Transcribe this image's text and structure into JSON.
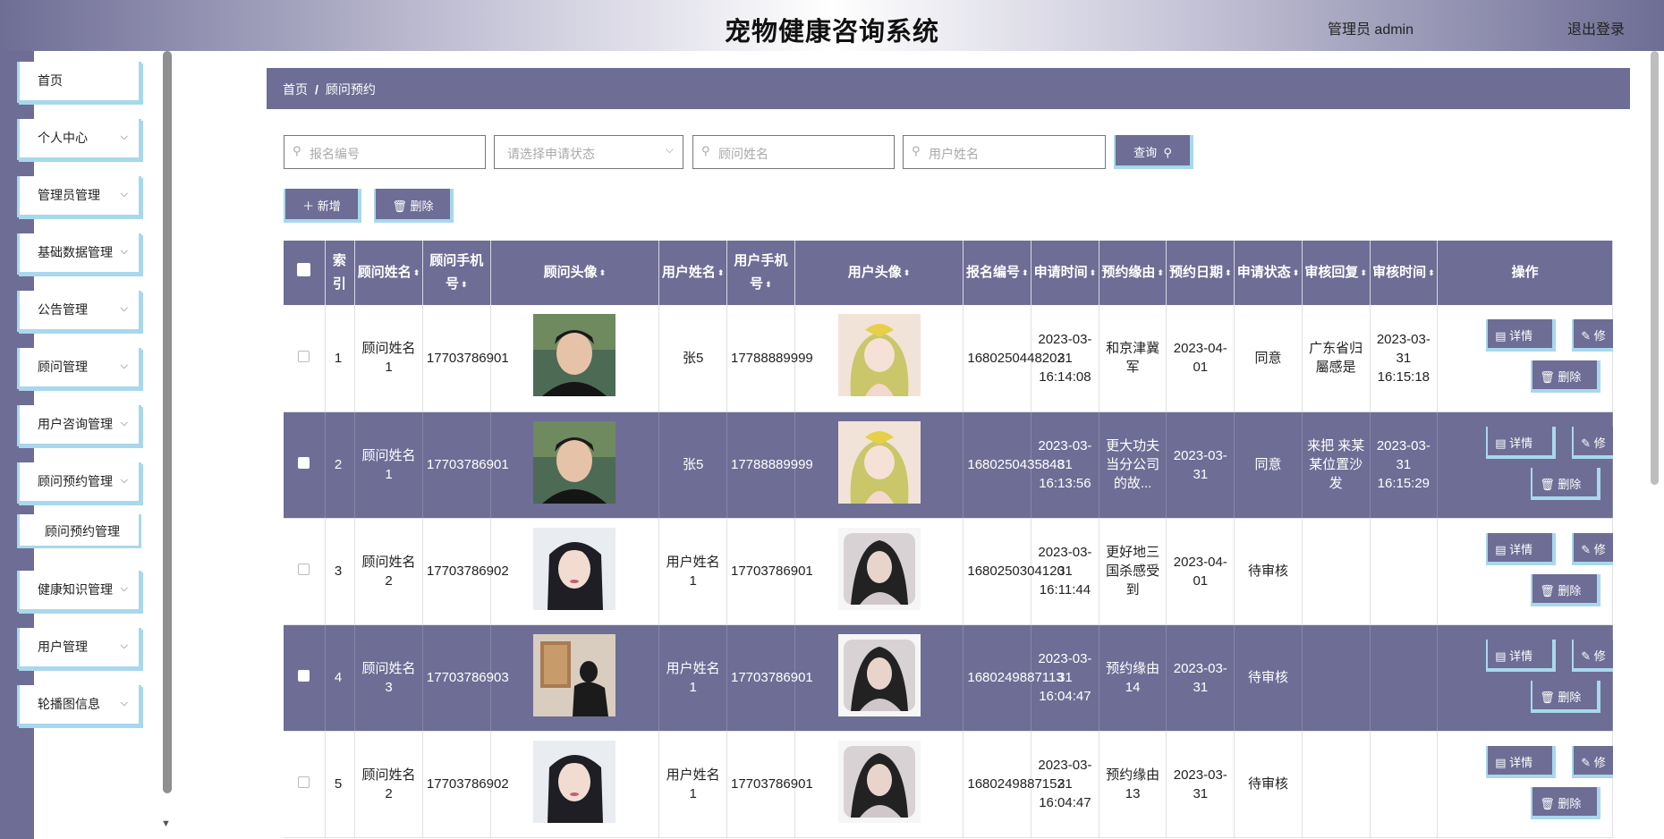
{
  "header": {
    "title": "宠物健康咨询系统",
    "user": "管理员 admin",
    "logout": "退出登录"
  },
  "sidebar": {
    "items": [
      {
        "label": "首页",
        "has_chevron": false
      },
      {
        "label": "个人中心",
        "has_chevron": true
      },
      {
        "label": "管理员管理",
        "has_chevron": true
      },
      {
        "label": "基础数据管理",
        "has_chevron": true
      },
      {
        "label": "公告管理",
        "has_chevron": true
      },
      {
        "label": "顾问管理",
        "has_chevron": true
      },
      {
        "label": "用户咨询管理",
        "has_chevron": true
      },
      {
        "label": "顾问预约管理",
        "has_chevron": true
      },
      {
        "label": "顾问预约管理",
        "has_chevron": false
      },
      {
        "label": "健康知识管理",
        "has_chevron": true
      },
      {
        "label": "用户管理",
        "has_chevron": true
      },
      {
        "label": "轮播图信息",
        "has_chevron": true
      }
    ]
  },
  "breadcrumb": {
    "home": "首页",
    "sep": "/",
    "current": "顾问预约"
  },
  "search": {
    "order_no_placeholder": "报名编号",
    "status_placeholder": "请选择申请状态",
    "advisor_name_placeholder": "顾问姓名",
    "user_name_placeholder": "用户姓名",
    "query_label": "查询"
  },
  "toolbar": {
    "add_label": "新增",
    "delete_label": "删除"
  },
  "table": {
    "headers": {
      "index": "索引",
      "advisor_name": "顾问姓名",
      "advisor_phone": "顾问手机号",
      "advisor_avatar": "顾问头像",
      "user_name": "用户姓名",
      "user_phone": "用户手机号",
      "user_avatar": "用户头像",
      "order_no": "报名编号",
      "apply_time": "申请时间",
      "reason": "预约缘由",
      "appointment_date": "预约日期",
      "apply_status": "申请状态",
      "review_reply": "审核回复",
      "review_time": "审核时间",
      "actions": "操作"
    },
    "action_labels": {
      "detail": "详情",
      "edit": "修",
      "delete": "删除"
    },
    "rows": [
      {
        "index": "1",
        "advisor_name": "顾问姓名1",
        "advisor_phone": "17703786901",
        "advisor_avatar": "man-portrait",
        "user_name": "张5",
        "user_phone": "17788889999",
        "user_avatar": "anime-girl",
        "order_no": "1680250448202",
        "apply_time": "2023-03-31 16:14:08",
        "reason": "和京津冀军",
        "appointment_date": "2023-04-01",
        "apply_status": "同意",
        "review_reply": "广东省归屬感是",
        "review_time": "2023-03-31 16:15:18"
      },
      {
        "index": "2",
        "advisor_name": "顾问姓名1",
        "advisor_phone": "17703786901",
        "advisor_avatar": "man-portrait",
        "user_name": "张5",
        "user_phone": "17788889999",
        "user_avatar": "anime-girl",
        "order_no": "1680250435848",
        "apply_time": "2023-03-31 16:13:56",
        "reason": "更大功夫当分公司的故...",
        "appointment_date": "2023-03-31",
        "apply_status": "同意",
        "review_reply": "来把 来某某位置沙发",
        "review_time": "2023-03-31 16:15:29"
      },
      {
        "index": "3",
        "advisor_name": "顾问姓名2",
        "advisor_phone": "17703786902",
        "advisor_avatar": "woman-portrait",
        "user_name": "用户姓名1",
        "user_phone": "17703786901",
        "user_avatar": "pillow-portrait",
        "order_no": "1680250304120",
        "apply_time": "2023-03-31 16:11:44",
        "reason": "更好地三国杀感受到",
        "appointment_date": "2023-04-01",
        "apply_status": "待审核",
        "review_reply": "",
        "review_time": ""
      },
      {
        "index": "4",
        "advisor_name": "顾问姓名3",
        "advisor_phone": "17703786903",
        "advisor_avatar": "gallery-man",
        "user_name": "用户姓名1",
        "user_phone": "17703786901",
        "user_avatar": "pillow-portrait",
        "order_no": "1680249887113",
        "apply_time": "2023-03-31 16:04:47",
        "reason": "预约缘由14",
        "appointment_date": "2023-03-31",
        "apply_status": "待审核",
        "review_reply": "",
        "review_time": ""
      },
      {
        "index": "5",
        "advisor_name": "顾问姓名2",
        "advisor_phone": "17703786902",
        "advisor_avatar": "woman-portrait",
        "user_name": "用户姓名1",
        "user_phone": "17703786901",
        "user_avatar": "pillow-portrait",
        "order_no": "1680249887152",
        "apply_time": "2023-03-31 16:04:47",
        "reason": "预约缘由13",
        "appointment_date": "2023-03-31",
        "apply_status": "待审核",
        "review_reply": "",
        "review_time": ""
      }
    ]
  },
  "colors": {
    "accent": "#6e6d95",
    "button_border": "#a8d8ec"
  }
}
